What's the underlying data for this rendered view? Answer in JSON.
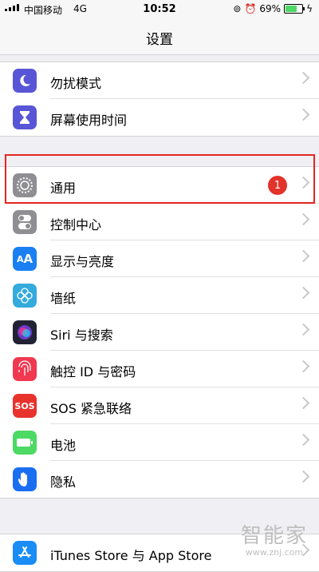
{
  "status_bar": {
    "carrier": "中国移动",
    "network": "4G",
    "time": "10:52",
    "battery": "69%",
    "battery_level": 0.69
  },
  "nav": {
    "title": "设置"
  },
  "group1": [
    {
      "label": "勿扰模式",
      "icon": "moon-icon",
      "color": "#5856d6"
    },
    {
      "label": "屏幕使用时间",
      "icon": "hourglass-icon",
      "color": "#5856d6"
    }
  ],
  "group2": [
    {
      "label": "通用",
      "icon": "gear-icon",
      "color": "#8e8e93",
      "badge": "1"
    },
    {
      "label": "控制中心",
      "icon": "toggles-icon",
      "color": "#8e8e93"
    },
    {
      "label": "显示与亮度",
      "icon": "text-size-icon",
      "color": "#1a7ff2"
    },
    {
      "label": "墙纸",
      "icon": "flower-icon",
      "color": "#35aadc"
    },
    {
      "label": "Siri 与搜索",
      "icon": "siri-icon",
      "color": "#222235"
    },
    {
      "label": "触控 ID 与密码",
      "icon": "fingerprint-icon",
      "color": "#f0384f"
    },
    {
      "label": "SOS 紧急联络",
      "icon": "sos-icon",
      "color": "#e8322c",
      "icon_text": "SOS"
    },
    {
      "label": "电池",
      "icon": "battery-icon",
      "color": "#4cd964"
    },
    {
      "label": "隐私",
      "icon": "hand-icon",
      "color": "#1a6ef0"
    }
  ],
  "group3": [
    {
      "label": "iTunes Store 与 App Store",
      "icon": "app-store-icon",
      "color": "#1a8cf5"
    }
  ],
  "watermark": {
    "line1": "智能家",
    "line2": "www.znj.com"
  }
}
